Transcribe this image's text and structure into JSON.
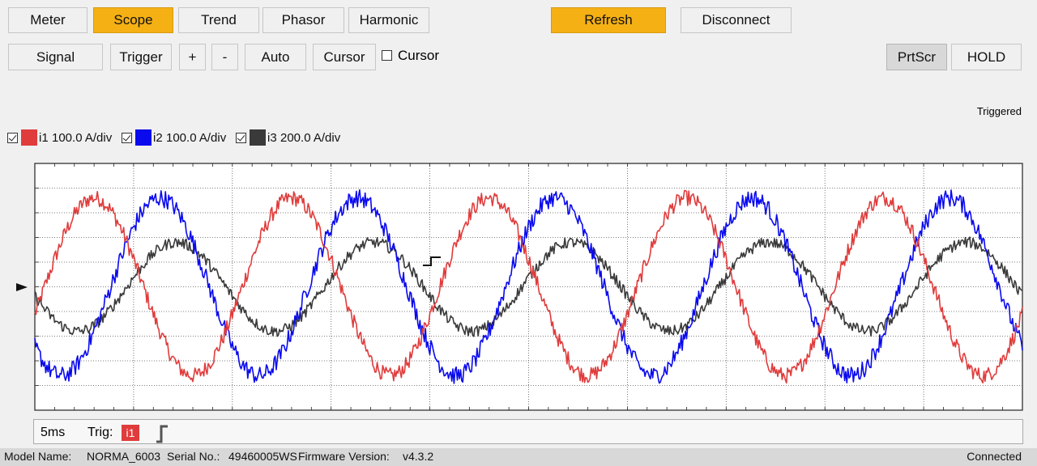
{
  "tabs": [
    {
      "label": "Meter",
      "active": false
    },
    {
      "label": "Scope",
      "active": true
    },
    {
      "label": "Trend",
      "active": false
    },
    {
      "label": "Phasor",
      "active": false
    },
    {
      "label": "Harmonic",
      "active": false
    }
  ],
  "top_actions": {
    "refresh": "Refresh",
    "disconnect": "Disconnect"
  },
  "toolbar": {
    "signal": "Signal",
    "trigger": "Trigger",
    "zoom_in": "+",
    "zoom_out": "-",
    "auto": "Auto",
    "cursor": "Cursor",
    "cursor_checkbox_label": "Cursor",
    "cursor_checked": false,
    "prtscr": "PrtScr",
    "hold": "HOLD"
  },
  "trigger_state": "Triggered",
  "channels": [
    {
      "name": "i1",
      "scale": "100.0 A/div",
      "color": "#e03c3c",
      "checked": true
    },
    {
      "name": "i2",
      "scale": "100.0 A/div",
      "color": "#0a0aee",
      "checked": true
    },
    {
      "name": "i3",
      "scale": "200.0 A/div",
      "color": "#3a3a3a",
      "checked": true
    }
  ],
  "timebase": "5ms",
  "trig": {
    "label": "Trig:",
    "channel": "i1",
    "edge_icon": "rising-edge-icon"
  },
  "status": {
    "model_label": "Model Name:",
    "model": "NORMA_6003",
    "serial_label": "Serial No.:",
    "serial": "49460005WS",
    "firmware_label": "Firmware Version:",
    "firmware": "v4.3.2",
    "connection": "Connected"
  },
  "chart_data": {
    "type": "line",
    "grid": true,
    "divisions": {
      "x": 10,
      "y": 10
    },
    "waveform": "sine",
    "cycles_shown": 5,
    "series": [
      {
        "name": "i1",
        "color": "#e03c3c",
        "amplitude_div": 4.0,
        "phase_deg": 0,
        "noise_div": 0.35
      },
      {
        "name": "i2",
        "color": "#0a0aee",
        "amplitude_div": 4.0,
        "phase_deg": -120,
        "noise_div": 0.4
      },
      {
        "name": "i3",
        "color": "#3a3a3a",
        "amplitude_div": 2.0,
        "phase_deg": -150,
        "noise_div": 0.25
      }
    ]
  }
}
